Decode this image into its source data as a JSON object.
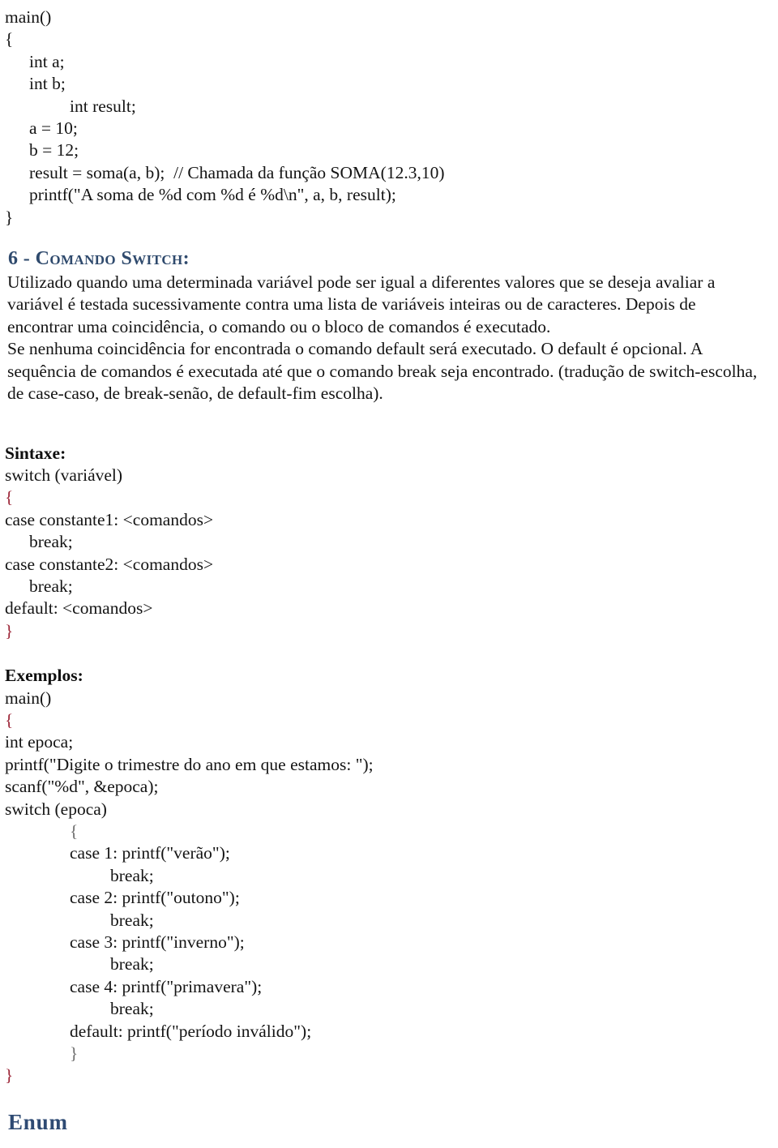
{
  "document": {
    "language": "pt-BR",
    "body_text_color": "#141414",
    "heading_color": "#2f4a6d",
    "brace_accent_color": "#9b2335"
  },
  "top_code_example": {
    "name": "soma-function-call-example",
    "lines": [
      {
        "indent": 0,
        "text": "main()",
        "style": "plain"
      },
      {
        "indent": 0,
        "text": "{",
        "style": "brace-dark"
      },
      {
        "indent": 1,
        "text": "int a;",
        "style": "plain"
      },
      {
        "indent": 1,
        "text": "int b;",
        "style": "plain"
      },
      {
        "indent": 2,
        "text": "int result;",
        "style": "plain"
      },
      {
        "indent": 1,
        "text": "a = 10;",
        "style": "plain"
      },
      {
        "indent": 1,
        "text": "b = 12;",
        "style": "plain"
      },
      {
        "indent": 1,
        "text": "result = soma(a, b);  // Chamada da função SOMA(12.3,10)",
        "style": "plain"
      },
      {
        "indent": 1,
        "text": "printf(\"A soma de %d com %d é %d\\n\", a, b, result);",
        "style": "plain"
      },
      {
        "indent": 0,
        "text": "}",
        "style": "brace-dark"
      }
    ]
  },
  "switch_section": {
    "heading": "6 - Comando Switch:",
    "paragraph_1": "Utilizado quando uma determinada variável pode ser igual a diferentes valores que se deseja avaliar a variável é testada sucessivamente contra uma lista de variáveis inteiras ou de caracteres. Depois de encontrar uma coincidência, o comando ou o bloco de comandos é executado.",
    "paragraph_2": "Se nenhuma coincidência for encontrada o comando default será executado. O default é opcional. A sequência de comandos é executada até que o comando break seja encontrado. (tradução de switch-escolha, de case-caso, de break-senão, de default-fim escolha)."
  },
  "syntax_section": {
    "label": "Sintaxe:",
    "lines": [
      {
        "indent": 0,
        "text": "switch (variável)",
        "style": "plain"
      },
      {
        "indent": 0,
        "text": "{",
        "style": "brace-red"
      },
      {
        "indent": 0,
        "text": "case constante1: <comandos>",
        "style": "plain"
      },
      {
        "indent": 1,
        "text": "break;",
        "style": "plain"
      },
      {
        "indent": 0,
        "text": "case constante2: <comandos>",
        "style": "plain"
      },
      {
        "indent": 1,
        "text": "break;",
        "style": "plain"
      },
      {
        "indent": 0,
        "text": "default: <comandos>",
        "style": "plain"
      },
      {
        "indent": 0,
        "text": "}",
        "style": "brace-red"
      }
    ]
  },
  "examples_section": {
    "label": "Exemplos:",
    "lines": [
      {
        "indent": 0,
        "text": "main()",
        "style": "plain"
      },
      {
        "indent": 0,
        "text": "{",
        "style": "brace-red"
      },
      {
        "indent": 0,
        "text": "int epoca;",
        "style": "plain"
      },
      {
        "indent": 0,
        "text": "printf(\"Digite o trimestre do ano em que estamos: \");",
        "style": "plain"
      },
      {
        "indent": 0,
        "text": "scanf(\"%d\", &epoca);",
        "style": "plain"
      },
      {
        "indent": 0,
        "text": "switch (epoca)",
        "style": "plain"
      },
      {
        "indent": 2,
        "text": "{",
        "style": "brace-gray"
      },
      {
        "indent": 2,
        "text": "case 1: printf(\"verão\");",
        "style": "plain"
      },
      {
        "indent": 3,
        "text": "break;",
        "style": "plain"
      },
      {
        "indent": 2,
        "text": "case 2: printf(\"outono\");",
        "style": "plain"
      },
      {
        "indent": 3,
        "text": "break;",
        "style": "plain"
      },
      {
        "indent": 2,
        "text": "case 3: printf(\"inverno\");",
        "style": "plain"
      },
      {
        "indent": 3,
        "text": "break;",
        "style": "plain"
      },
      {
        "indent": 2,
        "text": "case 4: printf(\"primavera\");",
        "style": "plain"
      },
      {
        "indent": 3,
        "text": "break;",
        "style": "plain"
      },
      {
        "indent": 2,
        "text": "default: printf(\"período inválido\");",
        "style": "plain"
      },
      {
        "indent": 2,
        "text": "}",
        "style": "brace-gray"
      },
      {
        "indent": 0,
        "text": "}",
        "style": "brace-red"
      }
    ]
  },
  "next_heading": {
    "title": "Enum"
  }
}
